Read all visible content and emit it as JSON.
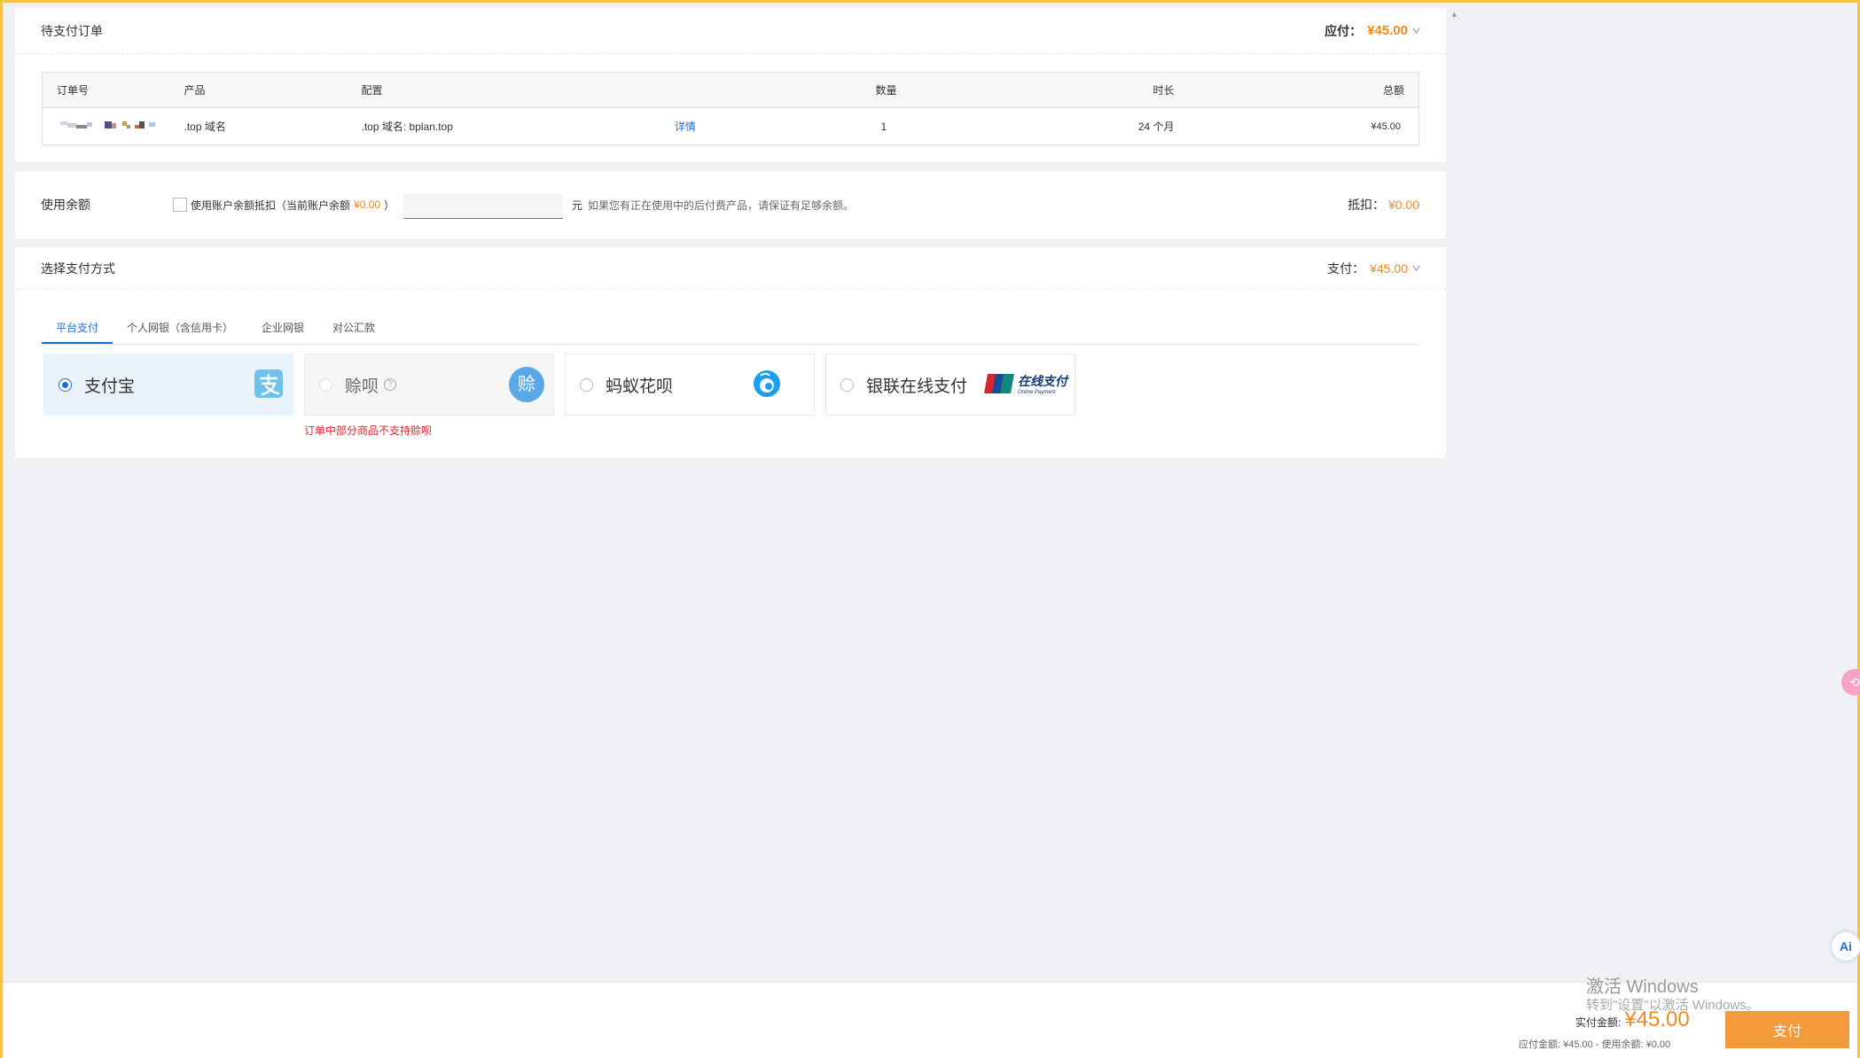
{
  "order": {
    "title": "待支付订单",
    "due_label": "应付：",
    "due_amount": "¥45.00",
    "columns": [
      "订单号",
      "产品",
      "配置",
      "数量",
      "时长",
      "总额"
    ],
    "row": {
      "product": ".top 域名",
      "config": ".top 域名: bplan.top",
      "detail_link": "详情",
      "qty": "1",
      "duration": "24 个月",
      "total": "¥45.00"
    }
  },
  "balance": {
    "label": "使用余额",
    "checkbox_text": "使用账户余额抵扣（当前账户余额",
    "current_balance": "¥0.00",
    "close_paren": "）",
    "unit": "元",
    "note": "如果您有正在使用中的后付费产品，请保证有足够余额。",
    "deduct_label": "抵扣：",
    "deduct_amount": "¥0.00"
  },
  "payment": {
    "title": "选择支付方式",
    "pay_label": "支付：",
    "pay_amount": "¥45.00",
    "tabs": [
      "平台支付",
      "个人网银（含信用卡）",
      "企业网银",
      "对公汇款"
    ],
    "options": [
      "支付宝",
      "赊呗",
      "蚂蚁花呗",
      "银联在线支付"
    ],
    "shebei_icon_text": "赊",
    "unionpay_text": "在线支付",
    "unionpay_sub": "Online Payment",
    "error": "订单中部分商品不支持赊呗"
  },
  "footer": {
    "actual_label": "实付金额:",
    "actual_amount": "¥45.00",
    "summary": "应付金额: ¥45.00 - 使用余额: ¥0.00",
    "pay_button": "支付"
  },
  "watermark": {
    "line1": "激活 Windows",
    "line2": "转到\"设置\"以激活 Windows。"
  },
  "float_ai": "Ai"
}
